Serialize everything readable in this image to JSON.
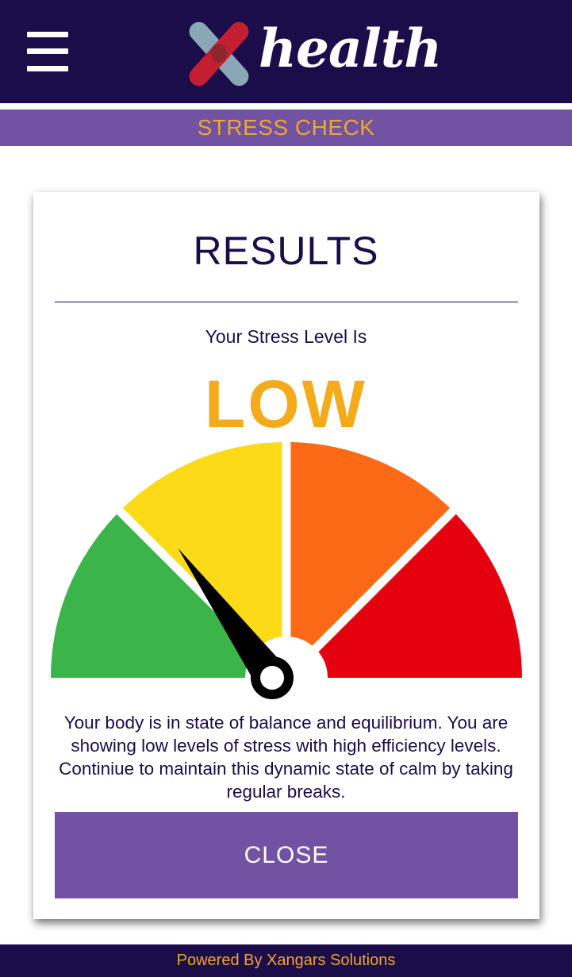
{
  "header": {
    "menu_icon": "hamburger-menu-icon",
    "logo_mark": "x-logo-icon",
    "logo_text": "health",
    "section_title": "STRESS CHECK"
  },
  "results": {
    "title": "RESULTS",
    "stress_label": "Your Stress Level Is",
    "stress_level": "LOW",
    "description": "Your body is in state of balance and equilibrium. You are showing low levels of stress with high efficiency levels. Continiue to maintain this dynamic state of calm by taking regular breaks.",
    "close_label": "CLOSE"
  },
  "gauge": {
    "segments": [
      {
        "level": "low",
        "color": "#3bb44a"
      },
      {
        "level": "moderate",
        "color": "#fdda17"
      },
      {
        "level": "high",
        "color": "#fd6a17"
      },
      {
        "level": "very-high",
        "color": "#e50010"
      }
    ],
    "needle_value": 0.3,
    "needle_color": "#000000"
  },
  "footer": {
    "text": "Powered By Xangars Solutions"
  },
  "colors": {
    "header_bg": "#1b0c4a",
    "accent_purple": "#7253a3",
    "accent_orange": "#f0a52c",
    "level_text": "#f4ab1b"
  }
}
